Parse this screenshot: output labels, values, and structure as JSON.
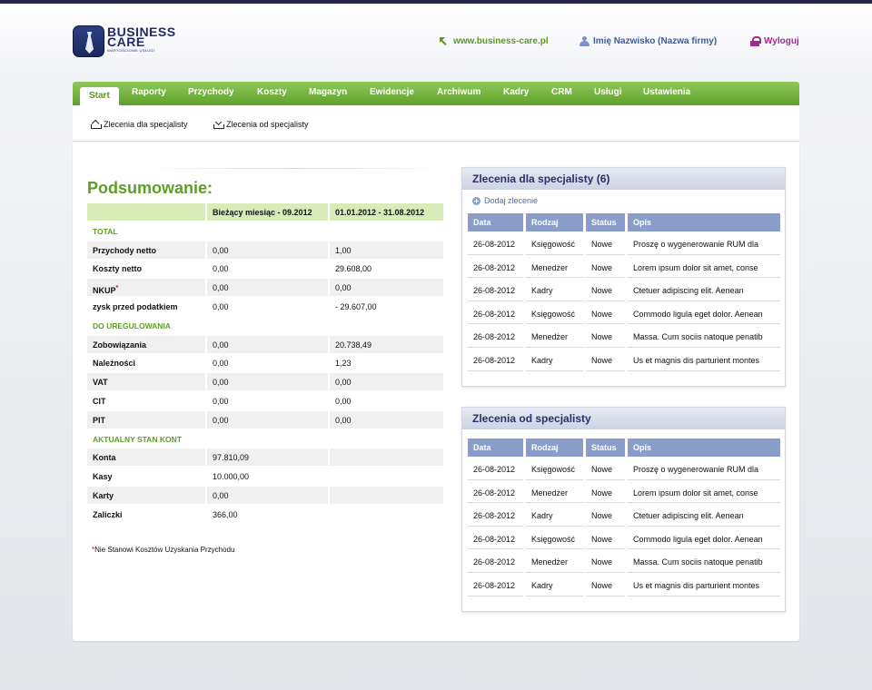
{
  "brand": {
    "line1": "BUSINESS",
    "line2": "CARE",
    "tagline": "WARTOŚCIOWE USŁUGI"
  },
  "header": {
    "site_link": "www.business-care.pl",
    "user": "Imię Nazwisko (Nazwa firmy)",
    "logout": "Wyloguj"
  },
  "nav": {
    "items": [
      "Start",
      "Raporty",
      "Przychody",
      "Koszty",
      "Magazyn",
      "Ewidencje",
      "Archiwum",
      "Kadry",
      "CRM",
      "Usługi",
      "Ustawienia"
    ]
  },
  "subnav": {
    "item1": "Zlecenia dla specjalisty",
    "item2": "Zlecenia od specjalisty"
  },
  "summary": {
    "title": "Podsumowanie:",
    "col1": "Bieżący miesiąc - 09.2012",
    "col2": "01.01.2012 - 31.08.2012",
    "section_total": "TOTAL",
    "section_due": "DO UREGULOWANIA",
    "section_accounts": "AKTUALNY STAN KONT",
    "rows": [
      {
        "label": "Przychody netto",
        "v1": "0,00",
        "v2": "1,00"
      },
      {
        "label": "Koszty netto",
        "v1": "0,00",
        "v2": "29.608,00"
      },
      {
        "label": "NKUP",
        "v1": "0,00",
        "v2": "0,00"
      },
      {
        "label": "zysk przed podatkiem",
        "v1": "0,00",
        "v2": "- 29.607,00"
      },
      {
        "label": "Zobowiązania",
        "v1": "0,00",
        "v2": "20.738,49"
      },
      {
        "label": "Należności",
        "v1": "0,00",
        "v2": "1,23"
      },
      {
        "label": "VAT",
        "v1": "0,00",
        "v2": "0,00"
      },
      {
        "label": "CIT",
        "v1": "0,00",
        "v2": "0,00"
      },
      {
        "label": "PIT",
        "v1": "0,00",
        "v2": "0,00"
      },
      {
        "label": "Konta",
        "v1": "97.810,09",
        "v2": ""
      },
      {
        "label": "Kasy",
        "v1": "10.000,00",
        "v2": ""
      },
      {
        "label": "Karty",
        "v1": "0,00",
        "v2": ""
      },
      {
        "label": "Zaliczki",
        "v1": "366,00",
        "v2": ""
      }
    ],
    "asterisk": "*",
    "footnote": "Nie Stanowi Kosztów Uzyskania Przychodu"
  },
  "panel1": {
    "title": "Zlecenia dla specjalisty (6)",
    "add_link": "Dodaj zlecenie"
  },
  "panel2": {
    "title": "Zlecenia od specjalisty"
  },
  "columns": [
    "Data",
    "Rodzaj",
    "Status",
    "Opis"
  ],
  "orders": [
    {
      "date": "26-08-2012",
      "type": "Księgowość",
      "status": "Nowe",
      "desc": "Proszę o wygenerowanie RUM dla"
    },
    {
      "date": "26-08-2012",
      "type": "Menedżer",
      "status": "Nowe",
      "desc": "Lorem ipsum dolor sit amet, conse"
    },
    {
      "date": "26-08-2012",
      "type": "Kadry",
      "status": "Nowe",
      "desc": "Ctetuer adipiscing elit. Aenean"
    },
    {
      "date": "26-08-2012",
      "type": "Księgowość",
      "status": "Nowe",
      "desc": "Commodo ligula eget dolor. Aenean"
    },
    {
      "date": "26-08-2012",
      "type": "Menedżer",
      "status": "Nowe",
      "desc": "Massa. Cum sociis natoque penatib"
    },
    {
      "date": "26-08-2012",
      "type": "Kadry",
      "status": "Nowe",
      "desc": "Us et magnis dis parturient montes"
    }
  ]
}
